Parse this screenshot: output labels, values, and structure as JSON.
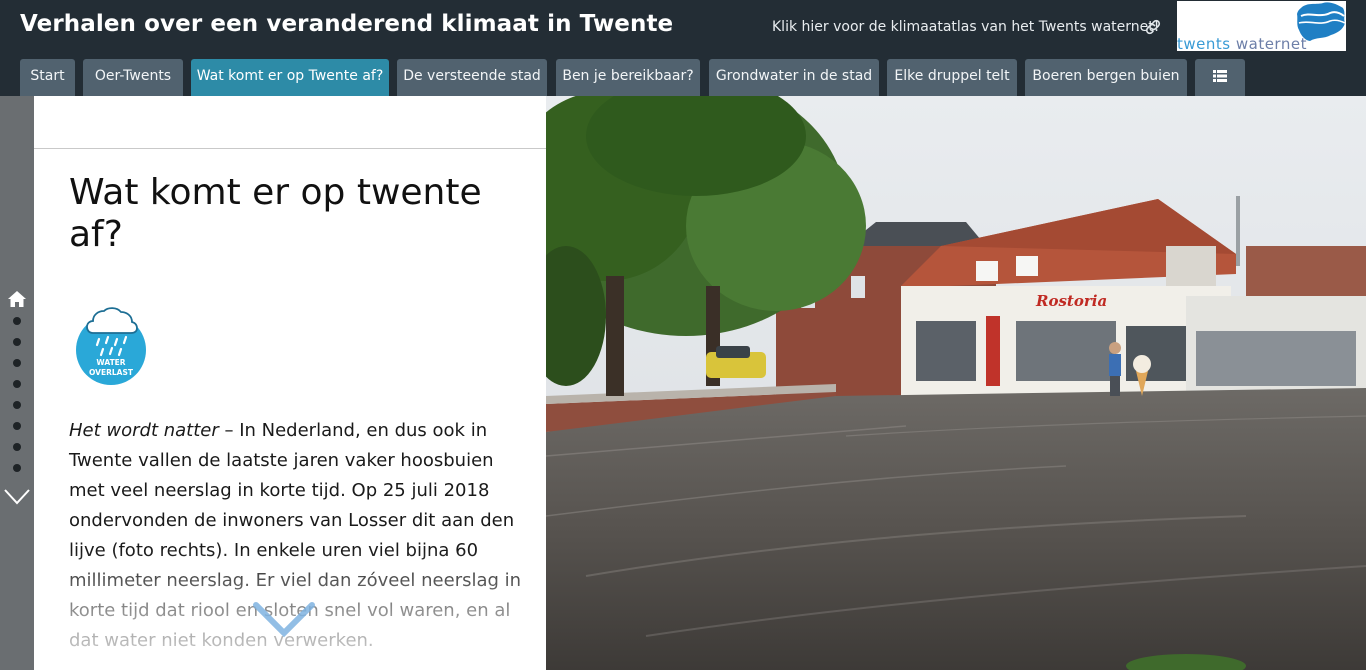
{
  "header": {
    "title": "Verhalen over een veranderend klimaat in Twente",
    "atlas_link": "Klik hier voor de klimaatatlas van het Twents waternet!",
    "link_icon": "link-icon",
    "logo": {
      "text_part1": "twents ",
      "text_part2": "waternet",
      "color_blue": "#3a9bd5",
      "color_purple": "#6d7fa8"
    }
  },
  "tabs": [
    {
      "label": "Start",
      "active": false
    },
    {
      "label": "Oer-Twents",
      "active": false
    },
    {
      "label": "Wat komt er op Twente af?",
      "active": true
    },
    {
      "label": "De versteende stad",
      "active": false
    },
    {
      "label": "Ben je bereikbaar?",
      "active": false
    },
    {
      "label": "Grondwater in de stad",
      "active": false
    },
    {
      "label": "Elke druppel telt",
      "active": false
    },
    {
      "label": "Boeren bergen buien",
      "active": false
    },
    {
      "label": "",
      "icon": "list-menu-icon",
      "active": false
    }
  ],
  "rail": {
    "home_icon": "home-icon",
    "dot_count": 8,
    "down_icon": "chevron-down-icon"
  },
  "panel": {
    "title": "Wat komt er op twente af?",
    "badge": {
      "line1": "WATER",
      "line2": "OVERLAST",
      "color": "#2aa8d8"
    },
    "intro_emphasis": "Het wordt natter",
    "body": " – In Nederland, en dus ook in Twente vallen de laatste jaren vaker hoosbuien met veel neerslag in korte tijd. Op 25 juli 2018 ondervonden de inwoners van Losser dit aan den lijve (foto rechts). In enkele uren viel bijna 60 millimeter neerslag. Er viel dan zóveel neerslag in korte tijd dat riool en sloten snel vol waren, en al dat water niet konden verwerken."
  },
  "photo": {
    "sign_text": "Rostoria"
  },
  "colors": {
    "header_bg": "#232d35",
    "tab_bg": "#51626f",
    "tab_active": "#2d8ba7",
    "rail_bg": "#6a6e71"
  }
}
